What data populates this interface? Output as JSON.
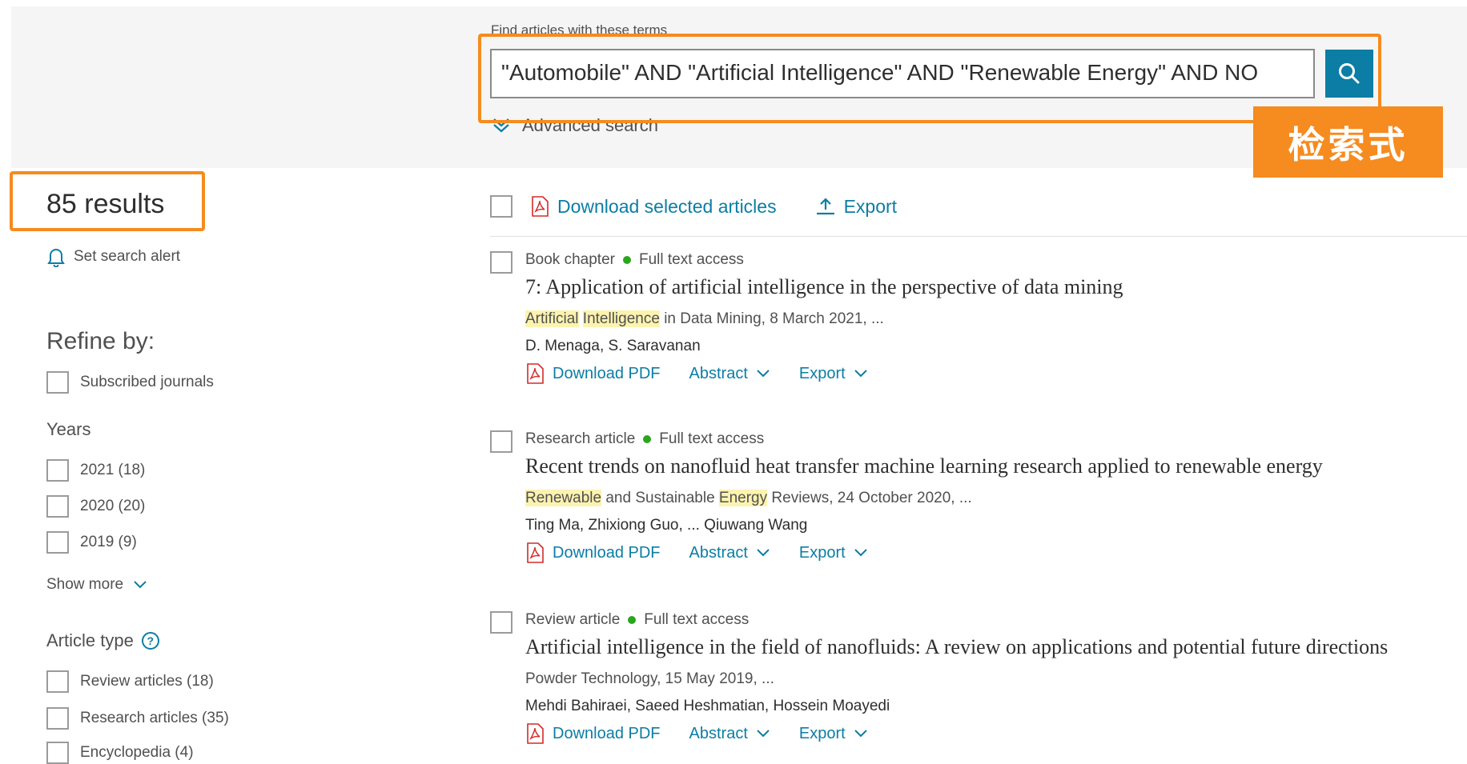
{
  "search": {
    "label": "Find articles with these terms",
    "query": "\"Automobile\" AND \"Artificial Intelligence\" AND \"Renewable Energy\" AND NO",
    "advanced": "Advanced search",
    "annotation_tag": "检索式"
  },
  "results": {
    "count": "85 results",
    "alert": "Set search alert"
  },
  "sidebar": {
    "refine": "Refine by:",
    "subscribed": "Subscribed journals",
    "years_heading": "Years",
    "years": [
      "2021 (18)",
      "2020 (20)",
      "2019 (9)"
    ],
    "show_more": "Show more",
    "article_type_heading": "Article type",
    "article_types": [
      "Review articles (18)",
      "Research articles (35)",
      "Encyclopedia (4)"
    ]
  },
  "toolbar": {
    "download_selected": "Download selected articles",
    "export": "Export"
  },
  "items": [
    {
      "type": "Book chapter",
      "access": "Full text access",
      "title": "7: Application of artificial intelligence in the perspective of data mining",
      "source_hl1": "Artificial",
      "source_hl2": "Intelligence",
      "source_rest": " in Data Mining, 8 March 2021, ...",
      "authors": "D. Menaga, S. Saravanan",
      "pdf": "Download PDF",
      "abstract": "Abstract",
      "export": "Export"
    },
    {
      "type": "Research article",
      "access": "Full text access",
      "title": "Recent trends on nanofluid heat transfer machine learning research applied to renewable energy",
      "source_hl1": "Renewable",
      "source_mid": " and Sustainable ",
      "source_hl2": "Energy",
      "source_rest": " Reviews, 24 October 2020, ...",
      "authors": "Ting Ma, Zhixiong Guo, ... Qiuwang Wang",
      "pdf": "Download PDF",
      "abstract": "Abstract",
      "export": "Export"
    },
    {
      "type": "Review article",
      "access": "Full text access",
      "title": "Artificial intelligence in the field of nanofluids: A review on applications and potential future directions",
      "source": "Powder Technology, 15 May 2019, ...",
      "authors": "Mehdi Bahiraei, Saeed Heshmatian, Hossein Moayedi",
      "pdf": "Download PDF",
      "abstract": "Abstract",
      "export": "Export"
    }
  ],
  "colors": {
    "accent": "#0c7da4",
    "annotation": "#f68b1f",
    "highlight": "#fdf3b0",
    "access_dot": "#29a61b"
  },
  "icons": [
    "search-icon",
    "bell-icon",
    "pdf-icon",
    "export-icon",
    "chevron-down-icon",
    "help-icon"
  ]
}
